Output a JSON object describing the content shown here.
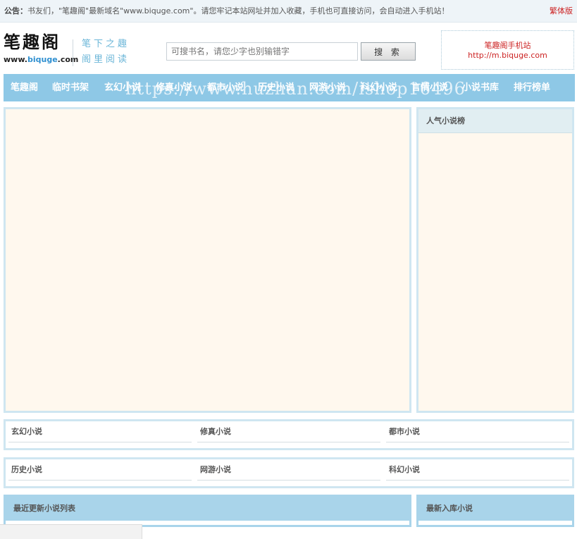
{
  "notice": {
    "label": "公告：",
    "text": "书友们，\"笔趣阁\"最新域名\"www.biquge.com\"。请您牢记本站网址并加入收藏，手机也可直接访问，会自动进入手机站！",
    "traditional_link": "繁体版"
  },
  "header": {
    "logo_text": "笔趣阁",
    "domain_prefix": "www.",
    "domain_mid": "biquge",
    "domain_suffix": ".com",
    "slogan_line1": "笔下之趣",
    "slogan_line2": "阁里阅读",
    "search_placeholder": "可搜书名，请您少字也别输错字",
    "search_button": "搜 索",
    "mobile_title": "笔趣阁手机站",
    "mobile_url": "http://m.biquge.com"
  },
  "nav": {
    "items": [
      "笔趣阁",
      "临时书架",
      "玄幻小说",
      "修真小说",
      "都市小说",
      "历史小说",
      "网游小说",
      "科幻小说",
      "言情小说",
      "小说书库",
      "排行榜单"
    ]
  },
  "watermark": "https://www.huzhan.com/ishop16496",
  "sidebar": {
    "popular_title": "人气小说榜"
  },
  "categories": {
    "row1": [
      "玄幻小说",
      "修真小说",
      "都市小说"
    ],
    "row2": [
      "历史小说",
      "网游小说",
      "科幻小说"
    ]
  },
  "bottom": {
    "recent_title": "最近更新小说列表",
    "newest_title": "最新入库小说"
  },
  "colors": {
    "nav_bg": "#8ec8e6",
    "panel_bg": "#fff8ee",
    "panel_border": "#cfe6f1",
    "alert_red": "#cc2222"
  }
}
